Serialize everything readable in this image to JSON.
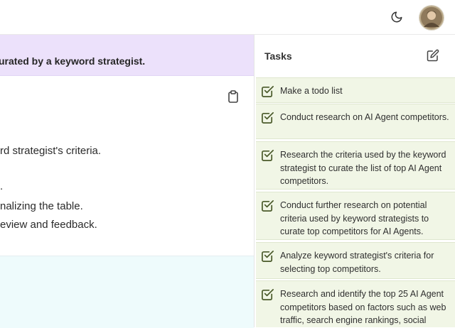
{
  "topbar": {
    "theme_icon": "moon-icon",
    "avatar": "user-avatar"
  },
  "main": {
    "banner_text": "urated by a keyword strategist.",
    "copy_icon": "clipboard-icon",
    "lines": [
      "rd strategist's criteria.",
      ".",
      "nalizing the table.",
      "eview and feedback."
    ]
  },
  "tasks": {
    "title": "Tasks",
    "edit_icon": "edit-icon",
    "items": [
      {
        "label": "Make a todo list",
        "done": true
      },
      {
        "label": "Conduct research on AI Agent competitors.",
        "done": true
      },
      {
        "label": "Research the criteria used by the keyword strategist to curate the list of top AI Agent competitors.",
        "done": true
      },
      {
        "label": "Conduct further research on potential criteria used by keyword strategists to curate top competitors for AI Agents.",
        "done": true
      },
      {
        "label": "Analyze keyword strategist's criteria for selecting top competitors.",
        "done": true
      },
      {
        "label": "Research and identify the top 25 AI Agent competitors based on factors such as web traffic, search engine rankings, social",
        "done": true
      }
    ]
  },
  "colors": {
    "banner_bg": "#ece1fb",
    "task_bg": "#f1f6e6",
    "check_color": "#4a5a2a",
    "bottom_bg": "#eefbfc"
  }
}
